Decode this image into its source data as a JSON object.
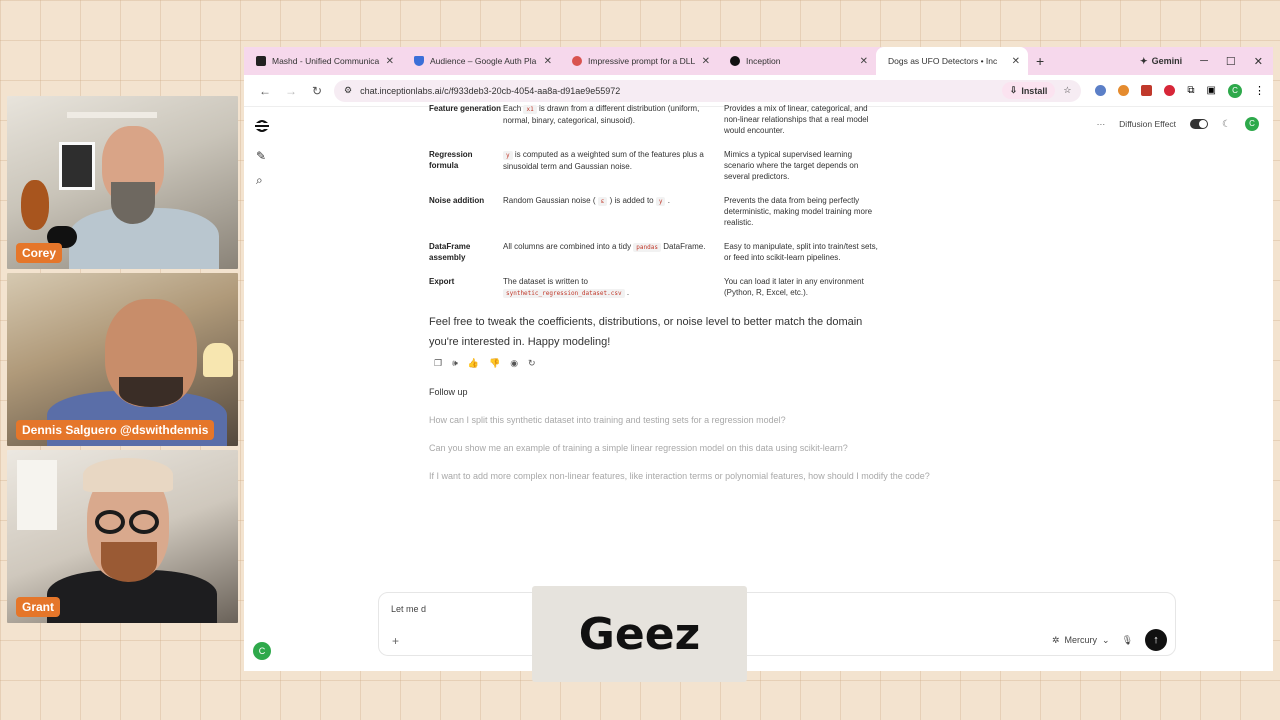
{
  "participants": [
    {
      "name": "Corey"
    },
    {
      "name": "Dennis Salguero @dswithdennis"
    },
    {
      "name": "Grant"
    }
  ],
  "browser": {
    "tabs": [
      {
        "title": "Mashd - Unified Communica",
        "icon_color": "#222222"
      },
      {
        "title": "Audience – Google Auth Pla",
        "icon_color": "#3b6fd8"
      },
      {
        "title": "Impressive prompt for a DLL",
        "icon_color": "#d9534f"
      },
      {
        "title": "Inception",
        "icon_color": "#111111"
      },
      {
        "title": "Dogs as UFO Detectors • Inc",
        "icon_color": "#ffffff",
        "active": true
      }
    ],
    "gemini_label": "Gemini",
    "url": "chat.inceptionlabs.ai/c/f933deb3-20cb-4054-aa8a-d91ae9e55972",
    "install_label": "Install",
    "profile_initial": "C"
  },
  "app": {
    "diffusion_label": "Diffusion Effect",
    "user_initial": "C",
    "table_rows": [
      {
        "step": "Feature generation",
        "desc_pre": "Each",
        "desc_code": "x1",
        "desc_post": "is drawn from a different distribution (uniform, normal, binary, categorical, sinusoid).",
        "why": "Provides a mix of linear, categorical, and non-linear relationships that a real model would encounter."
      },
      {
        "step": "Regression formula",
        "desc_pre": "",
        "desc_code": "y",
        "desc_post": "is computed as a weighted sum of the features plus a sinusoidal term and Gaussian noise.",
        "why": "Mimics a typical supervised learning scenario where the target depends on several predictors."
      },
      {
        "step": "Noise addition",
        "desc_pre": "Random Gaussian noise (",
        "desc_code": "ε",
        "desc_post": ") is added to",
        "desc_code2": "y",
        "desc_post2": ".",
        "why": "Prevents the data from being perfectly deterministic, making model training more realistic."
      },
      {
        "step": "DataFrame assembly",
        "desc_pre": "All columns are combined into a tidy",
        "desc_code": "pandas",
        "desc_post": "DataFrame.",
        "why": "Easy to manipulate, split into train/test sets, or feed into scikit-learn pipelines."
      },
      {
        "step": "Export",
        "desc_pre": "The dataset is written to",
        "desc_code": "synthetic_regression_dataset.csv",
        "desc_post": ".",
        "why": "You can load it later in any environment (Python, R, Excel, etc.)."
      }
    ],
    "closing_paragraph": "Feel free to tweak the coefficients, distributions, or noise level to better match the domain you're interested in. Happy modeling!",
    "followup_title": "Follow up",
    "followups": [
      "How can I split this synthetic dataset into training and testing sets for a regression model?",
      "Can you show me an example of training a simple linear regression model on this data using scikit-learn?",
      "If I want to add more complex non-linear features, like interaction terms or polynomial features, how should I modify the code?"
    ],
    "composer_text": "Let me d",
    "model_label": "Mercury"
  },
  "caption": "Geez"
}
